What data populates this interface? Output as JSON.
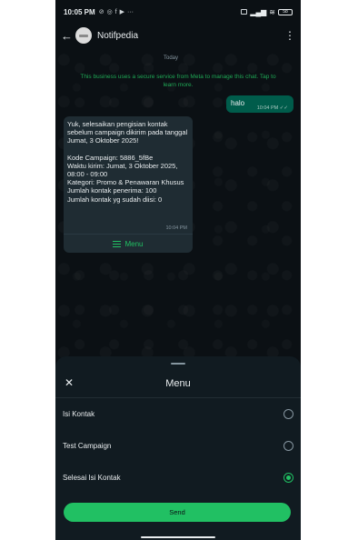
{
  "status_bar": {
    "time": "10:05 PM",
    "notification_icons": [
      "vibrate-off-icon",
      "whatsapp-icon",
      "facebook-icon",
      "youtube-icon",
      "more-dots-icon"
    ],
    "more": "···",
    "battery_level": "58"
  },
  "header": {
    "contact_name": "Notifpedia"
  },
  "chat": {
    "date_label": "Today",
    "secure_note": "This business uses a secure service from Meta to manage this chat. Tap to learn more.",
    "outgoing": {
      "text": "halo",
      "time": "10:04 PM"
    },
    "incoming": {
      "line1": "Yuk, selesaikan pengisian kontak sebelum campaign dikirim pada tanggal Jumat, 3 Oktober 2025!",
      "line2": "Kode Campaign: 5886_5fBe",
      "line3": "Waktu kirim: Jumat, 3 Oktober 2025, 08:00 - 09:00",
      "line4": "Kategori: Promo & Penawaran Khusus",
      "line5": "Jumlah kontak penerima: 100",
      "line6": "Jumlah kontak yg sudah diisi: 0",
      "time": "10:04 PM",
      "menu_label": "Menu"
    }
  },
  "sheet": {
    "close_glyph": "✕",
    "title": "Menu",
    "options": [
      {
        "label": "Isi Kontak",
        "selected": false
      },
      {
        "label": "Test Campaign",
        "selected": false
      },
      {
        "label": "Selesai Isi Kontak",
        "selected": true
      }
    ],
    "send_label": "Send"
  },
  "colors": {
    "accent": "#21c063",
    "background": "#0b1014",
    "incoming_bubble": "#1f2c33",
    "outgoing_bubble": "#005c4b",
    "sheet": "#111b21"
  }
}
